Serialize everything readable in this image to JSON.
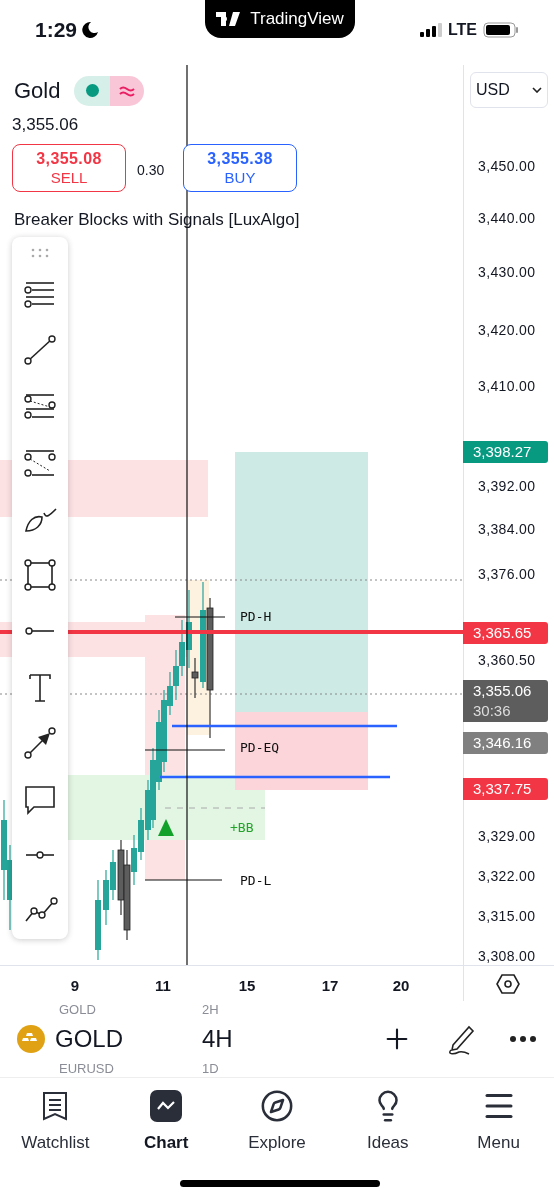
{
  "status_bar": {
    "time": "1:29",
    "network": "LTE"
  },
  "app_banner": {
    "title": "TradingView"
  },
  "symbol": {
    "name": "Gold",
    "price": "3,355.06",
    "sell": {
      "price": "3,355.08",
      "label": "SELL"
    },
    "spread": "0.30",
    "buy": {
      "price": "3,355.38",
      "label": "BUY"
    }
  },
  "indicator": {
    "name": "Breaker Blocks with Signals [LuxAlgo]"
  },
  "currency": "USD",
  "price_axis": {
    "ticks": [
      "3,450.00",
      "3,440.00",
      "3,430.00",
      "3,420.00",
      "3,410.00",
      "3,392.00",
      "3,384.00",
      "3,376.00",
      "3,360.50",
      "3,329.00",
      "3,322.00",
      "3,315.00",
      "3,308.00"
    ],
    "badges": [
      {
        "price": "3,398.27",
        "color": "#089981"
      },
      {
        "price": "3,365.65",
        "color": "#f23645"
      },
      {
        "price": "3,355.06",
        "countdown": "30:36",
        "color": "#5d5d5d"
      },
      {
        "price": "3,346.16",
        "color": "#808080"
      },
      {
        "price": "3,337.75",
        "color": "#f23645"
      }
    ]
  },
  "chart_labels": [
    {
      "text": "PD-H",
      "kind": "level"
    },
    {
      "text": "PD-EQ",
      "kind": "level"
    },
    {
      "text": "+BB",
      "kind": "signal"
    },
    {
      "text": "PD-L",
      "kind": "level"
    }
  ],
  "time_axis": {
    "labels": [
      "9",
      "11",
      "15",
      "17",
      "20"
    ]
  },
  "symbol_bar": {
    "previous": {
      "symbol": "GOLD",
      "interval": "2H"
    },
    "current": {
      "symbol": "GOLD",
      "interval": "4H"
    },
    "next": {
      "symbol": "EURUSD",
      "interval": "1D"
    }
  },
  "tabs": [
    {
      "label": "Watchlist",
      "selected": false
    },
    {
      "label": "Chart",
      "selected": true
    },
    {
      "label": "Explore",
      "selected": false
    },
    {
      "label": "Ideas",
      "selected": false
    },
    {
      "label": "Menu",
      "selected": false
    }
  ]
}
